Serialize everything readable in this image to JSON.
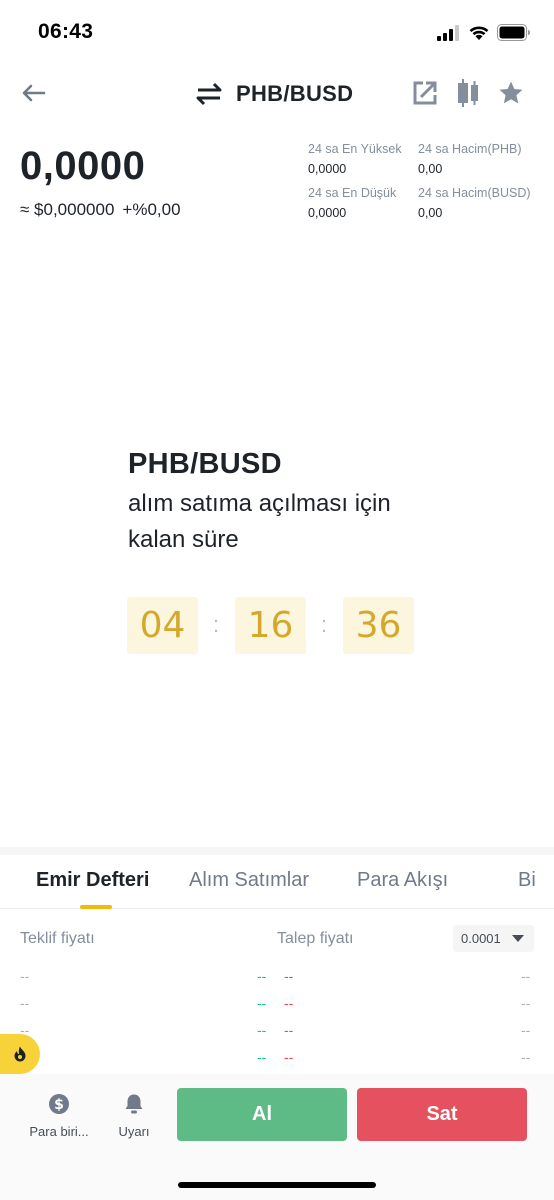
{
  "status_bar": {
    "time": "06:43"
  },
  "header": {
    "pair": "PHB/BUSD"
  },
  "price": {
    "last": "0,0000",
    "fiat": "≈ $0,000000",
    "change": "+%0,00"
  },
  "stats": {
    "high_label": "24 sa En Yüksek",
    "high_value": "0,0000",
    "vol_base_label": "24 sa Hacim(PHB)",
    "vol_base_value": "0,00",
    "low_label": "24 sa En Düşük",
    "low_value": "0,0000",
    "vol_quote_label": "24 sa Hacim(BUSD)",
    "vol_quote_value": "0,00"
  },
  "countdown": {
    "pair": "PHB/BUSD",
    "line1": "alım satıma açılması için",
    "line2": "kalan süre",
    "hours": "04",
    "minutes": "16",
    "seconds": "36",
    "separator": ":"
  },
  "tabs": [
    {
      "label": "Emir Defteri"
    },
    {
      "label": "Alım Satımlar"
    },
    {
      "label": "Para Akışı"
    },
    {
      "label": "Bi"
    }
  ],
  "orderbook": {
    "bid_header": "Teklif fiyatı",
    "ask_header": "Talep fiyatı",
    "precision": "0.0001",
    "placeholder": "--"
  },
  "bottom_bar": {
    "currency_label": "Para biri...",
    "alert_label": "Uyarı",
    "buy_label": "Al",
    "sell_label": "Sat"
  },
  "colors": {
    "accent": "#f0b90b",
    "buy": "#5fbb86",
    "sell": "#e5515e",
    "countdown_bg": "#fcf6df",
    "countdown_text": "#d4a82a"
  }
}
